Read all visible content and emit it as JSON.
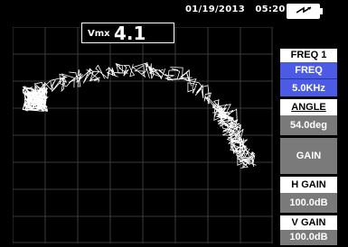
{
  "status": {
    "date": "01/19/2013",
    "time": "05:20",
    "battery_icon": "battery-charging-icon"
  },
  "vmx": {
    "label": "Vmx",
    "value": "4.1"
  },
  "menu": {
    "freq_title": "FREQ 1",
    "freq_label": "FREQ",
    "freq_value": "5.0KHz",
    "angle_label": "ANGLE",
    "angle_value": "54.0deg",
    "gain_label": "GAIN",
    "hgain_label": "H GAIN",
    "hgain_value": "100.0dB",
    "vgain_label": "V GAIN",
    "vgain_value": "100.0dB"
  },
  "colors": {
    "background": "#000000",
    "selected": "#4b5be6",
    "panel_gray": "#7a7a7a",
    "grid": "#3a3a3a",
    "signal": "#ffffff"
  }
}
